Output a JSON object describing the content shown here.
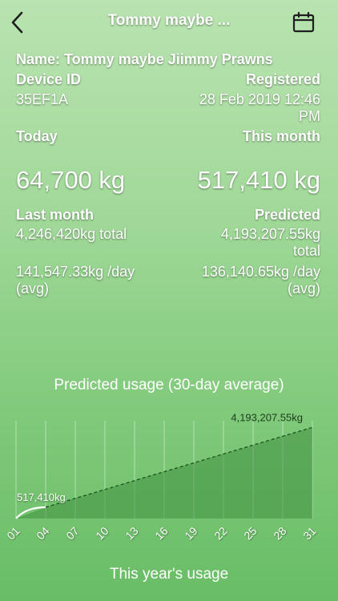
{
  "header": {
    "title": "Tommy maybe ...",
    "back_icon": "chevron-left-icon",
    "calendar_icon": "calendar-icon"
  },
  "device": {
    "name_text": "Name: Tommy maybe Jiimmy Prawns",
    "device_id_label": "Device ID",
    "device_id_value": "35EF1A",
    "registered_label": "Registered",
    "registered_value_line1": "28 Feb 2019 12:46",
    "registered_value_line2": "PM"
  },
  "today": {
    "label": "Today",
    "value": "64,700 kg"
  },
  "this_month": {
    "label": "This month",
    "value": "517,410 kg"
  },
  "last_month": {
    "label": "Last month",
    "total": "4,246,420kg  total",
    "avg_line1": "141,547.33kg /day",
    "avg_line2": "(avg)"
  },
  "predicted": {
    "label": "Predicted",
    "total_line1": "4,193,207.55kg",
    "total_line2": "total",
    "avg_line1": "136,140.65kg /day",
    "avg_line2": "(avg)"
  },
  "chart_title": "Predicted usage (30-day average)",
  "chart_data": {
    "type": "area",
    "title": "Predicted usage (30-day average)",
    "x_tick_labels": [
      "01",
      "04",
      "07",
      "10",
      "13",
      "16",
      "19",
      "22",
      "25",
      "28",
      "31"
    ],
    "xlim": [
      1,
      31
    ],
    "ylim": [
      0,
      4500000
    ],
    "grid": "vertical",
    "series": [
      {
        "role": "actual",
        "x": [
          1,
          4
        ],
        "y": [
          0,
          517410
        ],
        "style": "solid"
      },
      {
        "role": "predicted",
        "x": [
          4,
          31
        ],
        "y": [
          517410,
          4193207.55
        ],
        "style": "dashed"
      }
    ],
    "annotations": [
      {
        "text": "517,410kg",
        "x": 4,
        "y": 517410
      },
      {
        "text": "4,193,207.55kg",
        "x": 31,
        "y": 4193207.55
      }
    ],
    "colors": {
      "fill": "#3f8f3f",
      "line": "#1f5a23",
      "actual_line": "#ffffff",
      "grid": "#ffffff"
    }
  },
  "footer": {
    "text": "This year's usage"
  }
}
